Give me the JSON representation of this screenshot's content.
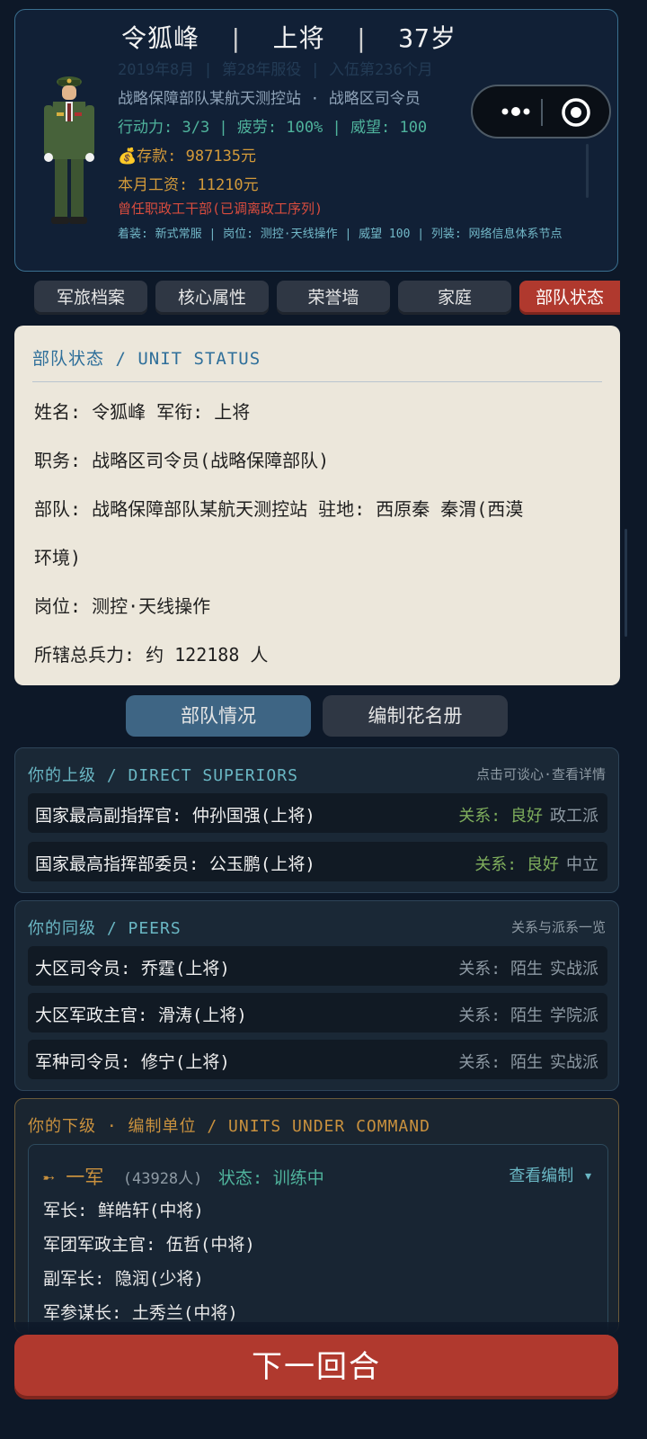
{
  "header": {
    "name": "令狐峰",
    "rank": "上将",
    "age": "37岁",
    "date_line": "2019年8月 | 第28年服役 | 入伍第236个月",
    "unit_line": "战略保障部队某航天测控站 · 战略区司令员",
    "stats_line": "行动力: 3/3 | 疲劳: 100% | 威望: 100",
    "savings": "💰存款: 987135元",
    "salary": "本月工资: 11210元",
    "past_role": "曾任职政工干部(已调离政工序列)",
    "extra": "着装: 新式常服 | 岗位: 测控·天线操作 | 威望 100 | 列装: 网络信息体系节点"
  },
  "tabs": [
    "军旅档案",
    "核心属性",
    "荣誉墙",
    "家庭",
    "部队状态"
  ],
  "status": {
    "title": "部队状态 / UNIT STATUS",
    "lines": [
      "姓名: 令狐峰   军衔: 上将",
      "职务: 战略区司令员(战略保障部队)",
      "部队: 战略保障部队某航天测控站  驻地: 西原秦 秦渭(西漠",
      "环境)",
      "岗位: 测控·天线操作",
      "所辖总兵力: 约 122188 人"
    ]
  },
  "subtabs": [
    "部队情况",
    "编制花名册"
  ],
  "superiors": {
    "title": "你的上级 / DIRECT SUPERIORS",
    "hint": "点击可谈心·查看详情",
    "rows": [
      {
        "name": "国家最高副指挥官: 仲孙国强(上将)",
        "rel": "关系: 良好",
        "faction": "政工派"
      },
      {
        "name": "国家最高指挥部委员: 公玉鹏(上将)",
        "rel": "关系: 良好",
        "faction": "中立"
      }
    ]
  },
  "peers": {
    "title": "你的同级 / PEERS",
    "hint": "关系与派系一览",
    "rows": [
      {
        "name": "大区司令员: 乔霆(上将)",
        "rel": "关系: 陌生",
        "faction": "实战派"
      },
      {
        "name": "大区军政主官: 滑涛(上将)",
        "rel": "关系: 陌生",
        "faction": "学院派"
      },
      {
        "name": "军种司令员: 修宁(上将)",
        "rel": "关系: 陌生",
        "faction": "实战派"
      }
    ]
  },
  "subordinates": {
    "title": "你的下级 · 编制单位 / UNITS UNDER COMMAND",
    "army": {
      "name": "➸ 一军",
      "count": "(43928人)",
      "state": "状态: 训练中",
      "view": "查看编制 ▾",
      "lines": [
        "军长: 鲜皓轩(中将)",
        "军团军政主官: 伍哲(中将)",
        "副军长: 隐润(少将)",
        "军参谋长: 土秀兰(中将)"
      ]
    }
  },
  "next_turn": "下一回合",
  "colors": {
    "background": "#0d1828",
    "accent_red": "#b0392e",
    "accent_teal": "#4fb39c",
    "accent_gold": "#c9913e",
    "card_cream": "#ece7db"
  },
  "icons": [
    "soldier-avatar-icon",
    "more-dots-icon",
    "record-target-icon"
  ]
}
